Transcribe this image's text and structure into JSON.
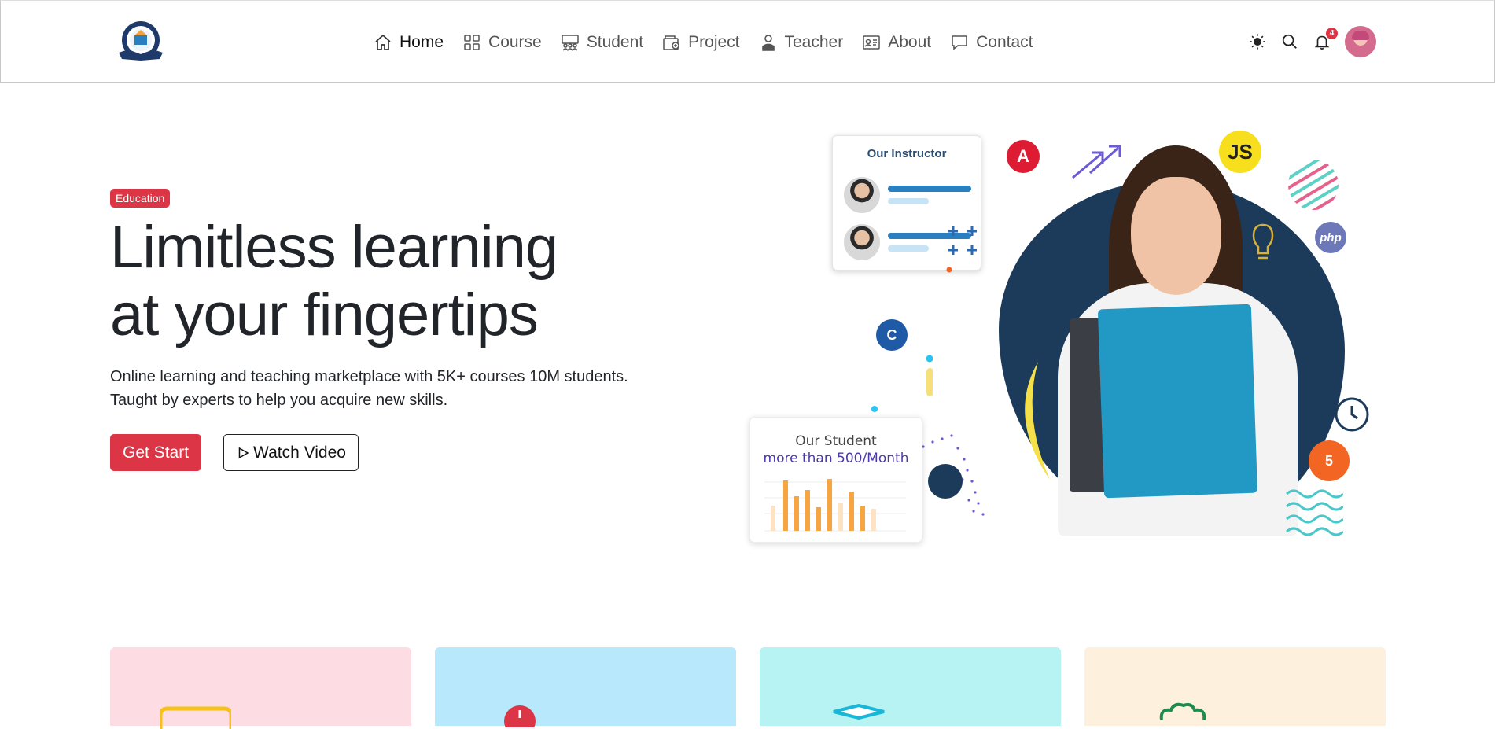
{
  "navbar": {
    "logo_name": "school-logo",
    "items": [
      {
        "label": "Home",
        "icon": "home-icon",
        "active": true
      },
      {
        "label": "Course",
        "icon": "grid-icon",
        "active": false
      },
      {
        "label": "Student",
        "icon": "students-icon",
        "active": false
      },
      {
        "label": "Project",
        "icon": "project-icon",
        "active": false
      },
      {
        "label": "Teacher",
        "icon": "teacher-icon",
        "active": false
      },
      {
        "label": "About",
        "icon": "id-card-icon",
        "active": false
      },
      {
        "label": "Contact",
        "icon": "chat-icon",
        "active": false
      }
    ],
    "notifications_count": "4",
    "right_icons": [
      "sun-icon",
      "search-icon",
      "bell-icon",
      "user-avatar"
    ]
  },
  "hero": {
    "badge": "Education",
    "title_line1": "Limitless learning",
    "title_line2": "at your fingertips",
    "description": "Online learning and teaching marketplace with 5K+ courses 10M students. Taught by experts to help you acquire new skills.",
    "primary_button": "Get Start",
    "secondary_button": "Watch Video"
  },
  "illustration": {
    "instructor_card_title": "Our Instructor",
    "student_card_title": "Our Student",
    "student_card_subtitle": "more than 500/Month",
    "tech_icons": [
      "angular-icon",
      "javascript-icon",
      "php-icon",
      "cpp-icon",
      "html5-icon",
      "clock-icon",
      "lightbulb-icon"
    ]
  },
  "features": {
    "card_colors": [
      "#fddde3",
      "#b8e8fb",
      "#b6f3f2",
      "#fdf1dd"
    ]
  },
  "colors": {
    "accent": "#dc3545",
    "blob": "#1c3a59"
  }
}
